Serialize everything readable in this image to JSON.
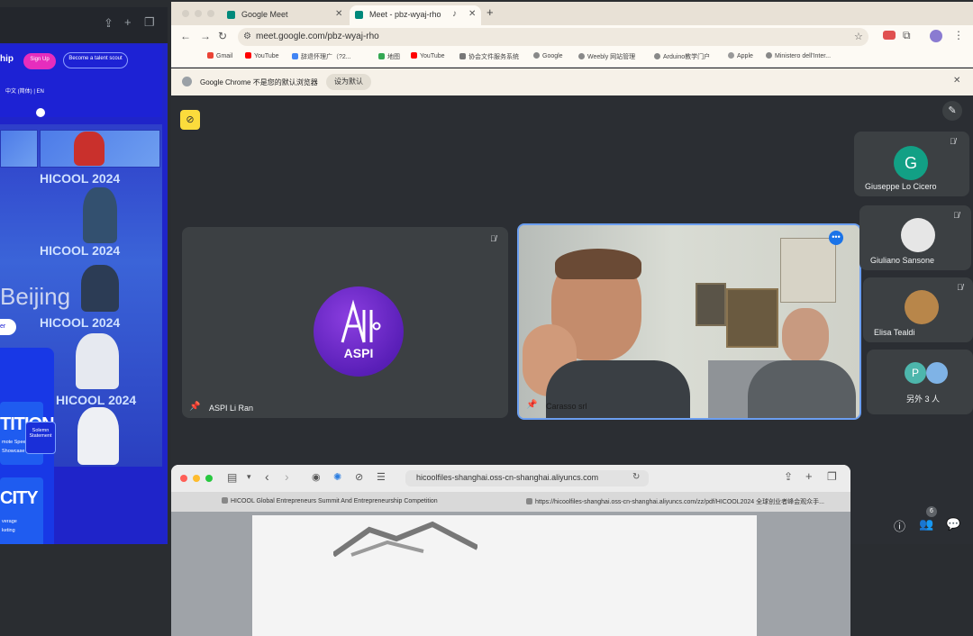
{
  "left_window": {
    "brand": "hip",
    "signup": "Sign Up",
    "talent_scout": "Become a talent scout",
    "lang": "中文 (简体) | EN",
    "overlay_text": "Beijing",
    "wall_title_1": "HICOOL 2024",
    "wall_title_2": "HICOOL 2024",
    "wall_title_3": "HICOOL 2024",
    "wall_title_4": "HICOOL 2024",
    "card_button": "er",
    "card_title_1": "TITION",
    "card_line_1": "mote Spee",
    "card_line_2": "Showcase",
    "card_title_2": "CITY",
    "card_line_3": "verage",
    "card_line_4": "keting",
    "solemn": "Solemn Statement"
  },
  "browser": {
    "tabs": [
      {
        "label": "Google Meet"
      },
      {
        "label": "Meet - pbz-wyaj-rho"
      }
    ],
    "new_tab": "+",
    "url": "meet.google.com/pbz-wyaj-rho",
    "bookmarks": [
      {
        "label": "Gmail",
        "color": "#ea4335"
      },
      {
        "label": "YouTube",
        "color": "#ff0000"
      },
      {
        "label": "辞退怀理广（?2...",
        "color": "#4285f4"
      },
      {
        "label": "地图",
        "color": "#34a853"
      },
      {
        "label": "YouTube",
        "color": "#ff0000"
      },
      {
        "label": "协会文件服务系统",
        "color": "#777777"
      },
      {
        "label": "Google",
        "color": "#888888"
      },
      {
        "label": "Weebly 网站管理",
        "color": "#888888"
      },
      {
        "label": "Arduino教学门户",
        "color": "#888888"
      },
      {
        "label": "Apple",
        "color": "#999999"
      },
      {
        "label": "Ministero dell'Inter...",
        "color": "#888888"
      }
    ],
    "infobar_text": "Google Chrome 不是您的默认浏览器",
    "set_default": "设为默认"
  },
  "meet": {
    "tiles": {
      "aspi": {
        "name": "ASPI Li Ran",
        "logo_text": "ASPI"
      },
      "carasso": {
        "name": "Carasso srl"
      },
      "giuseppe": {
        "name": "Giuseppe Lo Cicero",
        "initial": "G"
      },
      "giuliano": {
        "name": "Giuliano Sansone"
      },
      "elisa": {
        "name": "Elisa Tealdi"
      },
      "others": {
        "name": "另外 3 人",
        "initial": "P"
      }
    },
    "participants_count": "6"
  },
  "safari": {
    "url": "hicoolfiles-shanghai.oss-cn-shanghai.aliyuncs.com",
    "tab1": "HICOOL Global Entrepreneurs Summit And Entrepreneurship Competition",
    "tab2": "https://hicoolfiles-shanghai.oss-cn-shanghai.aliyuncs.com/zz/pdf/HICOOL2024 全球创业者峰会观众手..."
  }
}
